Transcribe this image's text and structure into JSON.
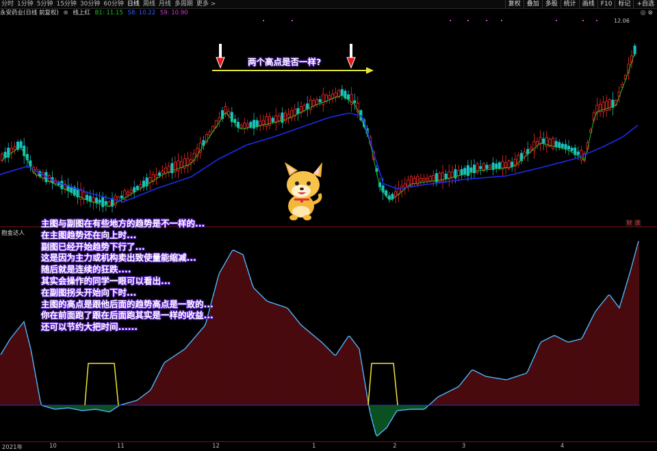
{
  "toolbar": {
    "tabs": [
      "分时",
      "1分钟",
      "5分钟",
      "15分钟",
      "30分钟",
      "60分钟",
      "日线",
      "周线",
      "月线",
      "多周期",
      "更多 >"
    ],
    "active_tab": "日线",
    "right_buttons": [
      "复权",
      "叠加",
      "多股",
      "统计",
      "画线",
      "F10",
      "标记",
      "+自选"
    ]
  },
  "info": {
    "stock_name": "永安药业(日线 前复权)",
    "indicator": "线上红",
    "b1": "B1: 11.15",
    "s8": "S8: 10.22",
    "s9": "S9: 10.90",
    "b1_color": "#20c020",
    "s8_color": "#3060ff",
    "s9_color": "#d040d0"
  },
  "max_price_label": "12.06",
  "annotation_top": "两个高点是否一样?",
  "annotation_lines": [
    "主图与副图在有些地方的趋势是不一样的...",
    "在主图趋势还在向上时...",
    "副图已经开始趋势下行了...",
    "这是因为主力或机构卖出致使量能缩减...",
    "随后就是连续的狂跌....",
    "其实会操作的同学一眼可以看出...",
    "在副图拐头开始向下时...",
    "主图的高点是跟他后面的趋势高点是一致的...",
    "你在前面跑了跟在后面跑其实是一样的收益...",
    "还可以节约大把时间......"
  ],
  "indicator_panel_label": "抱金达人",
  "badges": [
    "财",
    "涨"
  ],
  "date_axis": [
    {
      "label": "2021年",
      "pos": 0.3
    },
    {
      "label": "10",
      "pos": 7.5
    },
    {
      "label": "11",
      "pos": 17.8
    },
    {
      "label": "12",
      "pos": 32.3
    },
    {
      "label": "1",
      "pos": 47.5
    },
    {
      "label": "2",
      "pos": 59.8
    },
    {
      "label": "3",
      "pos": 70.3
    },
    {
      "label": "4",
      "pos": 85.3
    }
  ],
  "colors": {
    "up": "#ff2a2a",
    "down": "#17c3c3",
    "ma_short": "#22c022",
    "ma_long": "#1c2cf0",
    "osc_line": "#4fb6ff",
    "osc_pos": "#a0171e",
    "osc_neg": "#19b24a",
    "signal": "#f5e63b",
    "arrow": "#e81818"
  }
}
